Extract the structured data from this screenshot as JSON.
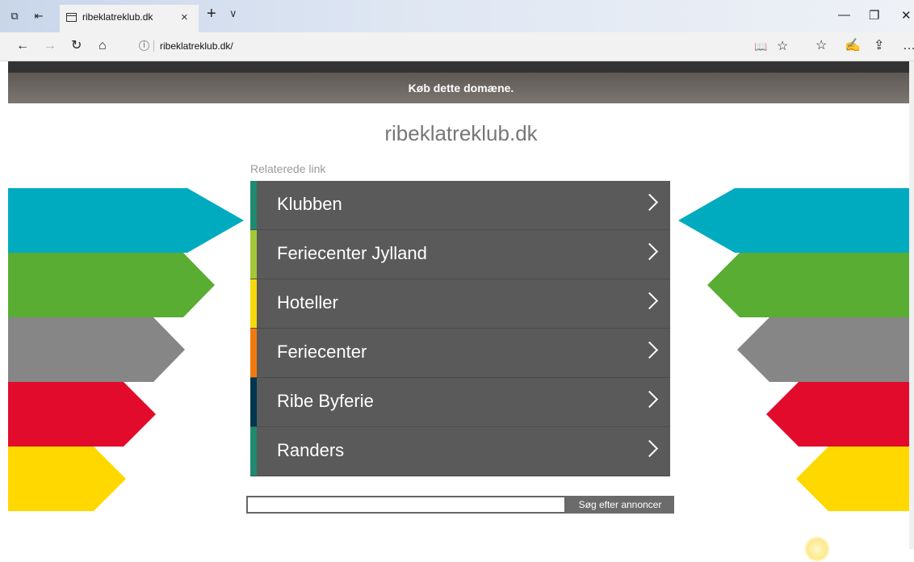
{
  "browser": {
    "tab_title": "ribeklatreklub.dk",
    "address": "ribeklatreklub.dk/"
  },
  "page": {
    "buy_banner": "Køb dette domæne.",
    "site_title": "ribeklatreklub.dk",
    "related_label": "Relaterede link",
    "links": [
      {
        "label": "Klubben",
        "color": "#1f8a70"
      },
      {
        "label": "Feriecenter Jylland",
        "color": "#a4c739"
      },
      {
        "label": "Hoteller",
        "color": "#f5d90a"
      },
      {
        "label": "Feriecenter",
        "color": "#f07a10"
      },
      {
        "label": "Ribe Byferie",
        "color": "#00364d"
      },
      {
        "label": "Randers",
        "color": "#1f8a70"
      }
    ],
    "search": {
      "input_value": "",
      "button_label": "Søg efter annoncer"
    }
  },
  "colors": {
    "teal": "#00abc0",
    "green": "#5aad33",
    "gray": "#868686",
    "red": "#e20b2c",
    "yellow": "#ffd800"
  }
}
